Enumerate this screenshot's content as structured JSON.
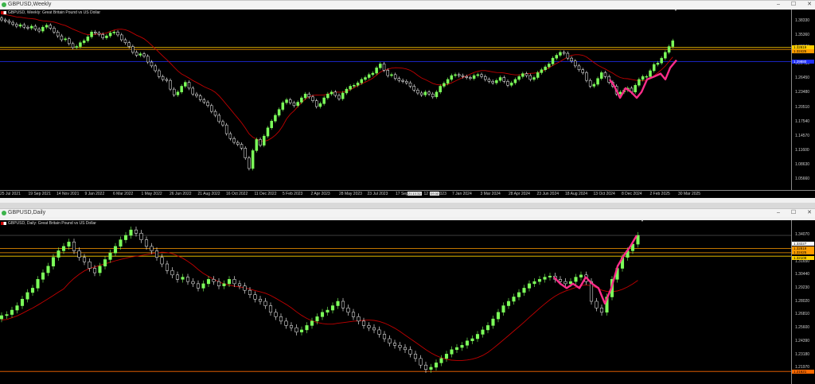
{
  "weekly": {
    "window_title": "GBPUSD,Weekly",
    "symbol_label": "GBPUSD, Weekly:  Great Britain Pound vs US Dollar",
    "win_buttons": [
      "–",
      "☐",
      "✕"
    ],
    "y_labels": [
      "1.38330",
      "1.35360",
      "1.32970",
      "1.29480",
      "1.26450",
      "1.23480",
      "1.20510",
      "1.17540",
      "1.14570",
      "1.11600",
      "1.08630",
      "1.05660"
    ],
    "price_tags": [
      {
        "text": "1.32819",
        "color": "#ffd000"
      },
      {
        "text": "1.32425",
        "color": "#ff9d00"
      },
      {
        "text": "1.29880",
        "color": "#2030ff"
      }
    ],
    "x_labels": [
      "25 Jul 2021",
      "19 Sep 2021",
      "14 Nov 2021",
      "9 Jan 2022",
      "6 Mar 2022",
      "1 May 2022",
      "26 Jun 2022",
      "21 Aug 2022",
      "16 Oct 2022",
      "11 Dec 2022",
      "5 Feb 2023",
      "2 Apr 2023",
      "28 May 2023",
      "23 Jul 2023",
      "17 Sep 2023",
      "12 Nov 2023",
      "7 Jan 2024",
      "3 Mar 2024",
      "28 Apr 2024",
      "23 Jun 2024",
      "18 Aug 2024",
      "13 Oct 2024",
      "8 Dec 2024",
      "2 Feb 2025",
      "30 Mar 2025"
    ],
    "time_boxes": [
      "21.10.22",
      "09:00"
    ],
    "closes": [
      1.385,
      1.383,
      1.38,
      1.376,
      1.372,
      1.375,
      1.37,
      1.368,
      1.372,
      1.366,
      1.362,
      1.37,
      1.374,
      1.368,
      1.36,
      1.352,
      1.344,
      1.346,
      1.336,
      1.328,
      1.33,
      1.338,
      1.342,
      1.35,
      1.36,
      1.358,
      1.355,
      1.348,
      1.352,
      1.358,
      1.36,
      1.354,
      1.344,
      1.338,
      1.33,
      1.318,
      1.312,
      1.315,
      1.31,
      1.298,
      1.29,
      1.28,
      1.268,
      1.262,
      1.26,
      1.242,
      1.23,
      1.236,
      1.248,
      1.256,
      1.244,
      1.232,
      1.228,
      1.22,
      1.215,
      1.208,
      1.196,
      1.188,
      1.175,
      1.168,
      1.15,
      1.14,
      1.132,
      1.128,
      1.12,
      1.1,
      1.078,
      1.115,
      1.138,
      1.126,
      1.145,
      1.162,
      1.176,
      1.188,
      1.2,
      1.214,
      1.22,
      1.214,
      1.208,
      1.215,
      1.224,
      1.232,
      1.226,
      1.218,
      1.206,
      1.212,
      1.224,
      1.232,
      1.236,
      1.229,
      1.222,
      1.234,
      1.242,
      1.248,
      1.25,
      1.255,
      1.262,
      1.266,
      1.272,
      1.275,
      1.286,
      1.294,
      1.281,
      1.27,
      1.272,
      1.264,
      1.26,
      1.258,
      1.255,
      1.248,
      1.24,
      1.234,
      1.23,
      1.236,
      1.232,
      1.226,
      1.236,
      1.248,
      1.254,
      1.262,
      1.27,
      1.272,
      1.27,
      1.268,
      1.266,
      1.264,
      1.27,
      1.272,
      1.268,
      1.262,
      1.258,
      1.255,
      1.26,
      1.266,
      1.258,
      1.25,
      1.255,
      1.262,
      1.268,
      1.274,
      1.27,
      1.262,
      1.266,
      1.276,
      1.282,
      1.288,
      1.294,
      1.306,
      1.312,
      1.318,
      1.316,
      1.306,
      1.3,
      1.29,
      1.282,
      1.276,
      1.26,
      1.248,
      1.252,
      1.264,
      1.276,
      1.268,
      1.256,
      1.248,
      1.232,
      1.236,
      1.24,
      1.244,
      1.236,
      1.25,
      1.262,
      1.268,
      1.268,
      1.28,
      1.293,
      1.296,
      1.306,
      1.318,
      1.33,
      1.342
    ]
  },
  "daily": {
    "window_title": "GBPUSD,Daily",
    "symbol_label": "GBPUSD, Daily:  Great Britain Pound vs US Dollar",
    "win_buttons": [
      "–",
      "☐",
      "✕"
    ],
    "y_labels": [
      "1.34070",
      "1.31650",
      "1.29230",
      "1.26810",
      "1.24390",
      "1.21970"
    ],
    "y_minor": [
      "1.30440",
      "1.28020",
      "1.25600",
      "1.23180"
    ],
    "price_tags": [
      {
        "text": "1.33227",
        "color": "#ffffff"
      },
      {
        "text": "1.32819",
        "color": "#ff9d00"
      },
      {
        "text": "1.32425",
        "color": "#ff9d00"
      },
      {
        "text": "1.32108",
        "color": "#ffd000"
      },
      {
        "text": "1.21621",
        "color": "#ff6a00"
      }
    ],
    "closes": [
      1.267,
      1.268,
      1.272,
      1.276,
      1.282,
      1.288,
      1.292,
      1.3,
      1.306,
      1.312,
      1.32,
      1.326,
      1.33,
      1.334,
      1.326,
      1.32,
      1.316,
      1.31,
      1.306,
      1.312,
      1.318,
      1.324,
      1.33,
      1.336,
      1.34,
      1.345,
      1.342,
      1.336,
      1.33,
      1.326,
      1.32,
      1.314,
      1.308,
      1.304,
      1.3,
      1.302,
      1.298,
      1.296,
      1.292,
      1.296,
      1.3,
      1.298,
      1.294,
      1.296,
      1.3,
      1.296,
      1.294,
      1.29,
      1.286,
      1.282,
      1.28,
      1.276,
      1.27,
      1.266,
      1.262,
      1.258,
      1.256,
      1.252,
      1.254,
      1.258,
      1.262,
      1.266,
      1.27,
      1.272,
      1.276,
      1.28,
      1.274,
      1.27,
      1.266,
      1.262,
      1.258,
      1.256,
      1.254,
      1.25,
      1.246,
      1.242,
      1.24,
      1.238,
      1.236,
      1.232,
      1.228,
      1.222,
      1.218,
      1.22,
      1.224,
      1.228,
      1.232,
      1.236,
      1.238,
      1.24,
      1.244,
      1.246,
      1.25,
      1.254,
      1.258,
      1.264,
      1.27,
      1.276,
      1.28,
      1.284,
      1.288,
      1.292,
      1.296,
      1.298,
      1.3,
      1.302,
      1.303,
      1.3,
      1.298,
      1.296,
      1.298,
      1.302,
      1.304,
      1.298,
      1.28,
      1.274,
      1.27,
      1.284,
      1.3,
      1.31,
      1.32,
      1.326,
      1.332,
      1.34
    ]
  }
}
